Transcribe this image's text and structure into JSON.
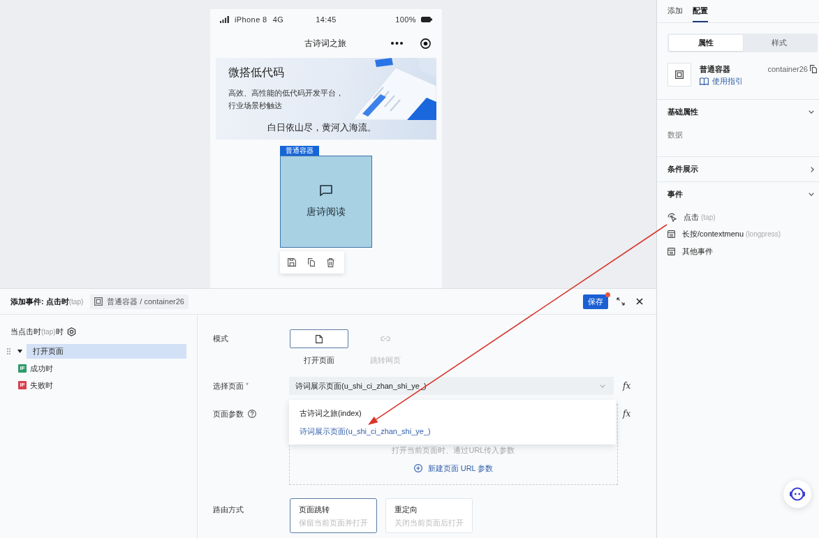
{
  "simulator": {
    "status_bar": {
      "carrier": "iPhone 8",
      "network": "4G",
      "time": "14:45",
      "battery": "100%"
    },
    "nav_bar": {
      "title": "古诗词之旅"
    },
    "banner": {
      "title": "微搭低代码",
      "lines": [
        "高效、高性能的低代码开发平台，",
        "行业场景秒触达"
      ],
      "caption": "白日依山尽，黄河入海流。"
    },
    "container": {
      "tag": "普通容器",
      "label": "唐诗阅读",
      "selected": true
    }
  },
  "side_panel": {
    "tabs": [
      {
        "label": "添加",
        "selected": false
      },
      {
        "label": "配置",
        "selected": true
      }
    ],
    "segments": [
      {
        "label": "属性",
        "selected": true
      },
      {
        "label": "样式",
        "selected": false
      }
    ],
    "component": {
      "name": "普通容器",
      "guide_link": "使用指引",
      "id": "container26"
    },
    "sections": [
      {
        "title": "基础属性",
        "expanded": true,
        "items": [
          {
            "kind": "field",
            "label": "数据"
          }
        ]
      },
      {
        "title": "条件展示",
        "expanded": false
      },
      {
        "title": "事件",
        "expanded": true,
        "items": [
          {
            "kind": "tap",
            "label": "点击",
            "hint": "(tap)"
          },
          {
            "kind": "event",
            "label": "长按/contextmenu",
            "hint": "(longpress)"
          },
          {
            "kind": "event",
            "label": "其他事件"
          }
        ]
      }
    ]
  },
  "event_drawer": {
    "title": "添加事件: 点击时",
    "title_hint": "(tap)",
    "breadcrumb": "普通容器 / container26",
    "save": "保存",
    "unsaved": true,
    "trigger": {
      "label": "当点击时",
      "hint": "(tap)",
      "suffix": "时"
    },
    "actions": [
      {
        "label": "打开页面",
        "selected": true,
        "expanded": true,
        "children": [
          {
            "badge": "IF",
            "label": "成功时",
            "color": "#2e9b6b"
          },
          {
            "badge": "IF",
            "label": "失败时",
            "color": "#d8404e"
          }
        ]
      }
    ],
    "form": {
      "mode": {
        "label": "模式",
        "options": [
          {
            "kind": "page",
            "label": "打开页面",
            "selected": true
          },
          {
            "kind": "link",
            "label": "跳转网页",
            "selected": false
          }
        ]
      },
      "page": {
        "label": "选择页面",
        "required_mark": "*",
        "value": "诗词展示页面(u_shi_ci_zhan_shi_ye_)",
        "formula": "fx",
        "expanded": true,
        "options": [
          {
            "label": "古诗词之旅(index)",
            "selected": false
          },
          {
            "label": "诗词展示页面(u_shi_ci_zhan_shi_ye_)",
            "selected": true
          }
        ]
      },
      "params": {
        "label": "页面参数",
        "formula": "fx",
        "hint": "打开当前页面时、通过URL传入参数",
        "add": "新建页面 URL 参数"
      },
      "route": {
        "label": "路由方式",
        "options": [
          {
            "title": "页面跳转",
            "desc": "保留当前页面并打开",
            "selected": true
          },
          {
            "title": "重定向",
            "desc": "关闭当前页面后打开",
            "selected": false
          }
        ]
      }
    }
  }
}
